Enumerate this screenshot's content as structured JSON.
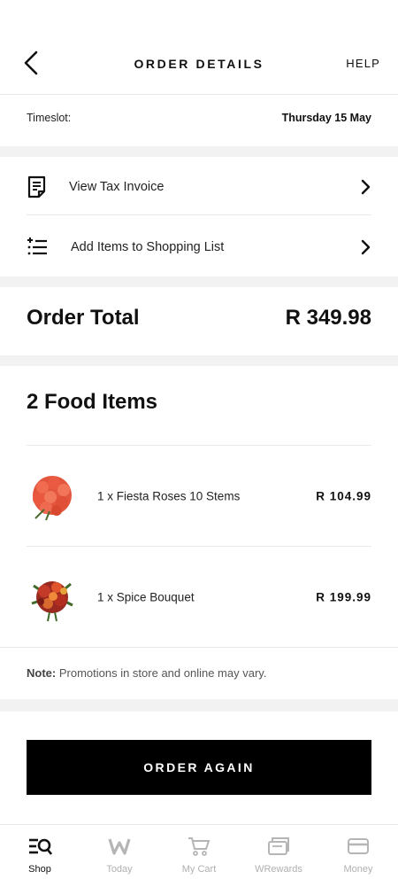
{
  "header": {
    "title": "ORDER DETAILS",
    "help_label": "HELP"
  },
  "timeslot": {
    "label": "Timeslot:",
    "value": "Thursday 15 May"
  },
  "actions": [
    {
      "label": "View Tax Invoice",
      "icon": "invoice-icon"
    },
    {
      "label": "Add Items to Shopping List",
      "icon": "add-to-list-icon"
    }
  ],
  "order_total": {
    "label": "Order Total",
    "value": "R 349.98"
  },
  "items_section": {
    "heading": "2 Food Items",
    "items": [
      {
        "name": "1 x Fiesta Roses 10 Stems",
        "price": "R 104.99"
      },
      {
        "name": "1 x Spice Bouquet",
        "price": "R 199.99"
      }
    ],
    "note_label": "Note:",
    "note_text": "Promotions in store and online may vary."
  },
  "cta": {
    "label": "ORDER AGAIN"
  },
  "tabbar": {
    "tabs": [
      {
        "label": "Shop",
        "active": true
      },
      {
        "label": "Today",
        "active": false
      },
      {
        "label": "My Cart",
        "active": false
      },
      {
        "label": "WRewards",
        "active": false
      },
      {
        "label": "Money",
        "active": false
      }
    ]
  }
}
